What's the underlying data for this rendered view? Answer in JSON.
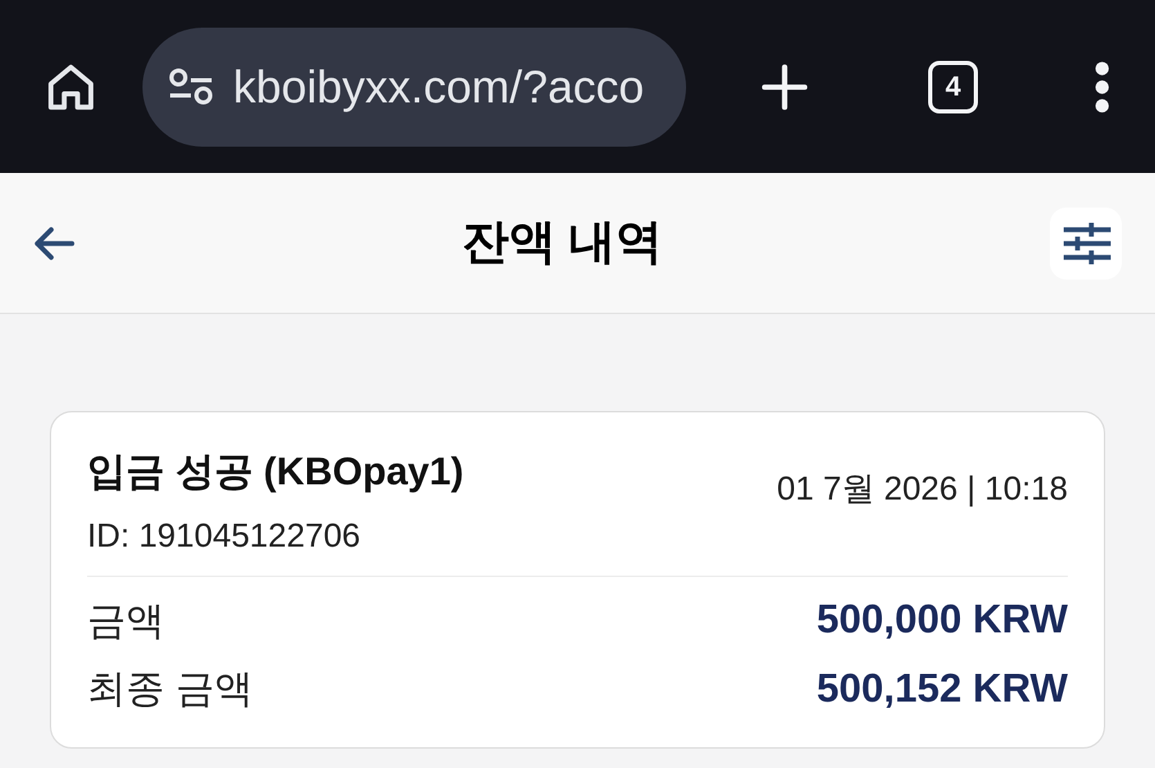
{
  "browser": {
    "url": "kboibyxx.com/?acco",
    "tab_count": "4"
  },
  "header": {
    "title": "잔액 내역"
  },
  "transactions": [
    {
      "title": "입금 성공 (KBOpay1)",
      "id": "ID: 191045122706",
      "datetime": "01 7월 2026 | 10:18",
      "rows": [
        {
          "label": "금액",
          "value": "500,000 KRW"
        },
        {
          "label": "최종 금액",
          "value": "500,152 KRW"
        }
      ]
    }
  ]
}
